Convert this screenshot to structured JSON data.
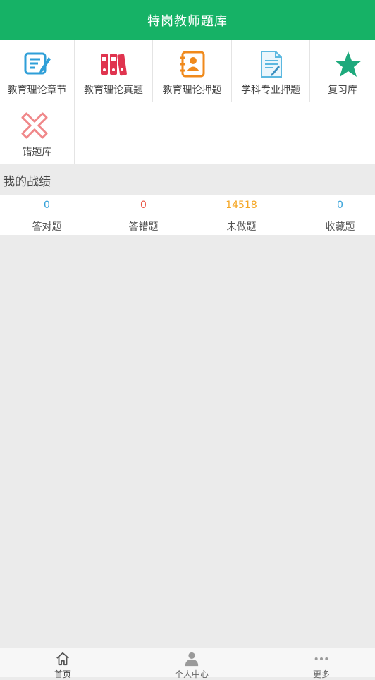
{
  "header": {
    "title": "特岗教师题库"
  },
  "grid": {
    "items": [
      {
        "label": "教育理论章节",
        "icon": "edit-note-icon",
        "color": "#2f9fd8"
      },
      {
        "label": "教育理论真题",
        "icon": "binders-icon",
        "color": "#e0344f"
      },
      {
        "label": "教育理论押题",
        "icon": "contact-book-icon",
        "color": "#f08a1c"
      },
      {
        "label": "学科专业押题",
        "icon": "document-pen-icon",
        "color": "#5bb8e0"
      },
      {
        "label": "复习库",
        "icon": "star-icon",
        "color": "#1ea97c"
      },
      {
        "label": "错题库",
        "icon": "cross-icon",
        "color": "#f0888a"
      }
    ]
  },
  "stats_section": {
    "title": "我的战绩",
    "items": [
      {
        "value": "0",
        "label": "答对题",
        "color": "#2f9fd8"
      },
      {
        "value": "0",
        "label": "答错题",
        "color": "#e8503f"
      },
      {
        "value": "14518",
        "label": "未做题",
        "color": "#f5a623"
      },
      {
        "value": "0",
        "label": "收藏题",
        "color": "#2f9fd8"
      }
    ]
  },
  "tabbar": {
    "items": [
      {
        "label": "首页",
        "icon": "home-icon"
      },
      {
        "label": "个人中心",
        "icon": "user-icon"
      },
      {
        "label": "更多",
        "icon": "more-dots-icon"
      }
    ]
  }
}
